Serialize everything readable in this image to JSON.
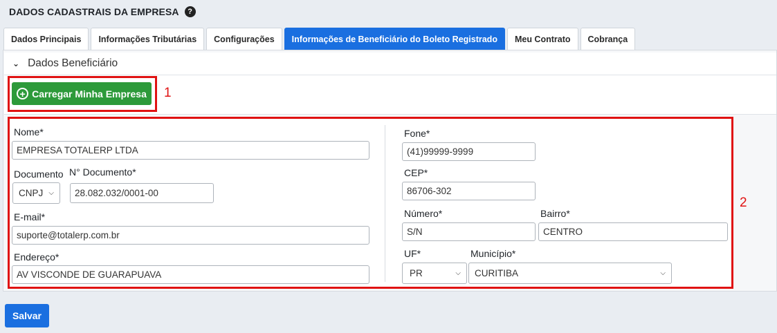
{
  "header": {
    "title": "DADOS CADASTRAIS DA EMPRESA",
    "help_glyph": "?"
  },
  "tabs": [
    {
      "label": "Dados Principais",
      "active": false
    },
    {
      "label": "Informações Tributárias",
      "active": false
    },
    {
      "label": "Configurações",
      "active": false
    },
    {
      "label": "Informações de Beneficiário do Boleto Registrado",
      "active": true
    },
    {
      "label": "Meu Contrato",
      "active": false
    },
    {
      "label": "Cobrança",
      "active": false
    }
  ],
  "section": {
    "title": "Dados Beneficiário",
    "chevron": "⌄"
  },
  "load_button": {
    "label": "Carregar Minha Empresa",
    "icon": "plus-circle-icon",
    "glyph": "+"
  },
  "callouts": {
    "one": "1",
    "two": "2"
  },
  "form": {
    "nome": {
      "label": "Nome*",
      "value": "EMPRESA TOTALERP LTDA"
    },
    "documento": {
      "label": "Documento",
      "value": "CNPJ"
    },
    "numero_documento": {
      "label": "N° Documento*",
      "value": "28.082.032/0001-00"
    },
    "email": {
      "label": "E-mail*",
      "value": "suporte@totalerp.com.br"
    },
    "endereco": {
      "label": "Endereço*",
      "value": "AV VISCONDE DE GUARAPUAVA"
    },
    "fone": {
      "label": "Fone*",
      "value": "(41)99999-9999"
    },
    "cep": {
      "label": "CEP*",
      "value": "86706-302"
    },
    "numero": {
      "label": "Número*",
      "value": "S/N"
    },
    "bairro": {
      "label": "Bairro*",
      "value": "CENTRO"
    },
    "uf": {
      "label": "UF*",
      "value": "PR"
    },
    "municipio": {
      "label": "Município*",
      "value": "CURITIBA"
    }
  },
  "save_button": {
    "label": "Salvar"
  },
  "colors": {
    "primary": "#1a6fe0",
    "success": "#2d9a3a",
    "highlight": "#e01212"
  }
}
